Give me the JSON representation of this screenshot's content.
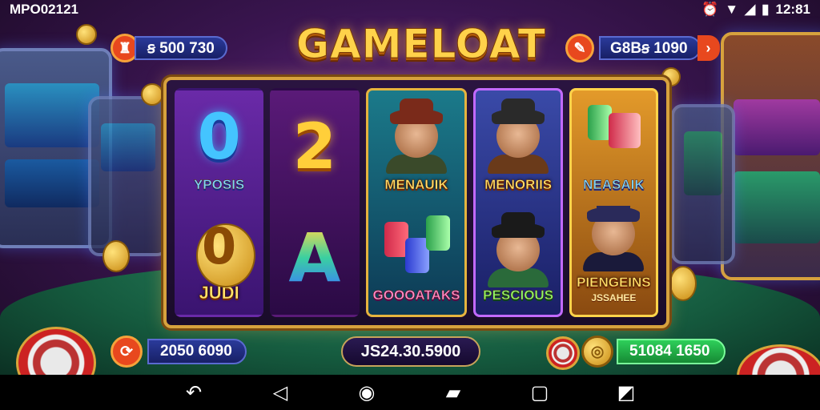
{
  "status_bar": {
    "carrier": "MPO02121",
    "time": "12:81",
    "icons": [
      "alarm-icon",
      "wifi-icon",
      "signal-icon",
      "battery-icon"
    ]
  },
  "header": {
    "title": "GAMELOAT",
    "left_balance": {
      "icon": "trophy-icon",
      "value": "ꞩ 500 730"
    },
    "right_balance": {
      "icon": "card-icon",
      "value": "G8Bꞩ 1090"
    }
  },
  "reels": [
    {
      "top": {
        "glyph": "0",
        "label": "YPOSIS"
      },
      "bottom": {
        "glyph": "0",
        "label": "JUDI"
      }
    },
    {
      "top": {
        "glyph": "2"
      },
      "bottom": {
        "glyph": "A"
      }
    },
    {
      "top": {
        "label": "MENAUIK"
      },
      "bottom": {
        "label": "GOOOATAKS"
      }
    },
    {
      "top": {
        "label": "MENORIIS"
      },
      "bottom": {
        "label": "PESCIOUS"
      }
    },
    {
      "top": {
        "label": "NEASAIK"
      },
      "bottom": {
        "label": "PIENGEINS",
        "sub": "JSSAHEE"
      }
    }
  ],
  "footer": {
    "left_value": "2050 6090",
    "total": "JS24.30.5900",
    "right_value": "51084 1650"
  },
  "colors": {
    "accent": "#d7a23d",
    "title": "#ffd24a",
    "win_green": "#22a84a"
  }
}
